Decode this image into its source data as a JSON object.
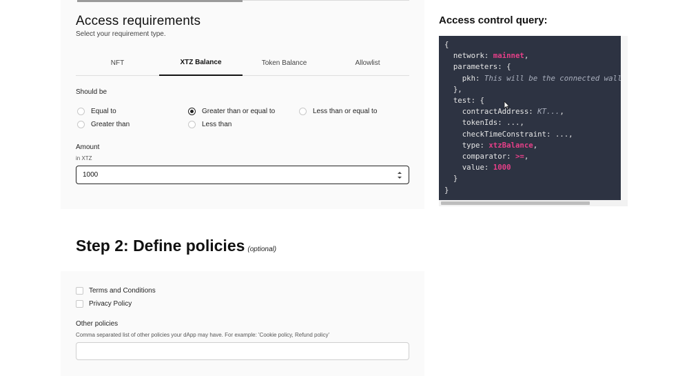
{
  "access": {
    "title": "Access requirements",
    "subtitle": "Select your requirement type.",
    "tabs": [
      {
        "label": "NFT",
        "active": false
      },
      {
        "label": "XTZ Balance",
        "active": true
      },
      {
        "label": "Token Balance",
        "active": false
      },
      {
        "label": "Allowlist",
        "active": false
      }
    ],
    "should_be_label": "Should be",
    "options": [
      {
        "label": "Equal to",
        "checked": false
      },
      {
        "label": "Greater than or equal to",
        "checked": true
      },
      {
        "label": "Less than or equal to",
        "checked": false
      },
      {
        "label": "Greater than",
        "checked": false
      },
      {
        "label": "Less than",
        "checked": false
      }
    ],
    "amount_label": "Amount",
    "amount_unit": "in XTZ",
    "amount_value": "1000"
  },
  "step2": {
    "title": "Step 2: Define policies",
    "optional": "(optional)",
    "checkboxes": [
      {
        "label": "Terms and Conditions",
        "checked": false
      },
      {
        "label": "Privacy Policy",
        "checked": false
      }
    ],
    "other_label": "Other policies",
    "other_help": "Comma separated list of other policies your dApp may have. For example: 'Cookie policy, Refund policy'",
    "other_value": ""
  },
  "query": {
    "title": "Access control query:",
    "lines": {
      "l1": "{",
      "l2_key": "  network: ",
      "l2_val": "mainnet",
      "l2_end": ",",
      "l3": "  parameters: {",
      "l4_key": "    pkh: ",
      "l4_cm": "This will be the connected wallet a",
      "l5": "  },",
      "l6": "  test: {",
      "l7_key": "    contractAddress: ",
      "l7_cm": "KT...",
      "l7_end": ",",
      "l8": "    tokenIds: ...,",
      "l9": "    checkTimeConstraint: ...,",
      "l10_key": "    type: ",
      "l10_val": "xtzBalance",
      "l10_end": ",",
      "l11_key": "    comparator: ",
      "l11_val": ">=",
      "l11_end": ",",
      "l12_key": "    value: ",
      "l12_val": "1000",
      "l13": "  }",
      "l14": "}"
    }
  },
  "colors": {
    "code_bg": "#2d3342",
    "code_accent": "#e63f88",
    "card_bg": "#fafafa"
  }
}
